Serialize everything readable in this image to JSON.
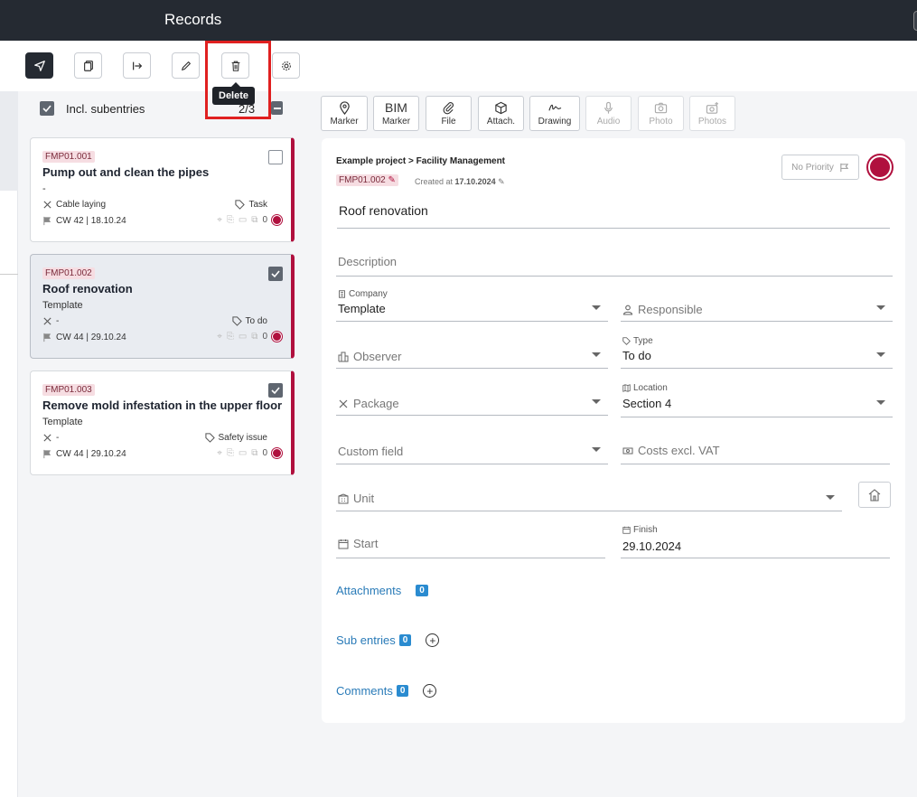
{
  "app": {
    "title": "Records"
  },
  "toolbar": {
    "tooltip": "Delete",
    "buttons": [
      "send-icon",
      "copy-icon",
      "export-icon",
      "edit-icon",
      "trash-icon",
      "gear-icon"
    ]
  },
  "list": {
    "incl_subentries_label": "Incl. subentries",
    "count": "2/3",
    "cards": [
      {
        "id": "FMP01.001",
        "title": "Pump out and clean the pipes",
        "subtitle": "-",
        "package": "Cable laying",
        "type": "Task",
        "date": "CW 42 | 18.10.24",
        "count": "0",
        "checked": false
      },
      {
        "id": "FMP01.002",
        "title": "Roof renovation",
        "subtitle": "Template",
        "package": "-",
        "type": "To do",
        "date": "CW 44 | 29.10.24",
        "count": "0",
        "checked": true
      },
      {
        "id": "FMP01.003",
        "title": "Remove mold infestation in the upper floor",
        "subtitle": "Template",
        "package": "-",
        "type": "Safety issue",
        "date": "CW 44 | 29.10.24",
        "count": "0",
        "checked": true
      }
    ]
  },
  "media_tools": [
    {
      "label": "Marker",
      "icon": "pin-icon"
    },
    {
      "label": "Marker",
      "top": "BIM"
    },
    {
      "label": "File",
      "icon": "paperclip-icon"
    },
    {
      "label": "Attach.",
      "icon": "cube-icon"
    },
    {
      "label": "Drawing",
      "icon": "signature-icon"
    },
    {
      "label": "Audio",
      "icon": "mic-icon"
    },
    {
      "label": "Photo",
      "icon": "camera-icon"
    },
    {
      "label": "Photos",
      "icon": "camera-plus-icon"
    }
  ],
  "detail": {
    "breadcrumb": "Example project > Facility Management",
    "id": "FMP01.002",
    "created_label": "Created at",
    "created_date": "17.10.2024",
    "priority": "No Priority",
    "title": "Roof renovation",
    "description_placeholder": "Description",
    "company_label": "Company",
    "company_value": "Template",
    "responsible_placeholder": "Responsible",
    "observer_placeholder": "Observer",
    "type_label": "Type",
    "type_value": "To do",
    "package_placeholder": "Package",
    "location_label": "Location",
    "location_value": "Section 4",
    "custom_field_placeholder": "Custom field",
    "costs_placeholder": "Costs excl. VAT",
    "unit_placeholder": "Unit",
    "start_placeholder": "Start",
    "finish_label": "Finish",
    "finish_value": "29.10.2024",
    "attachments_label": "Attachments",
    "attachments_count": "0",
    "subentries_label": "Sub entries",
    "subentries_count": "0",
    "comments_label": "Comments",
    "comments_count": "0"
  },
  "colors": {
    "accent": "#b0103e",
    "link": "#2a7bb8",
    "topbar": "#252a32"
  }
}
